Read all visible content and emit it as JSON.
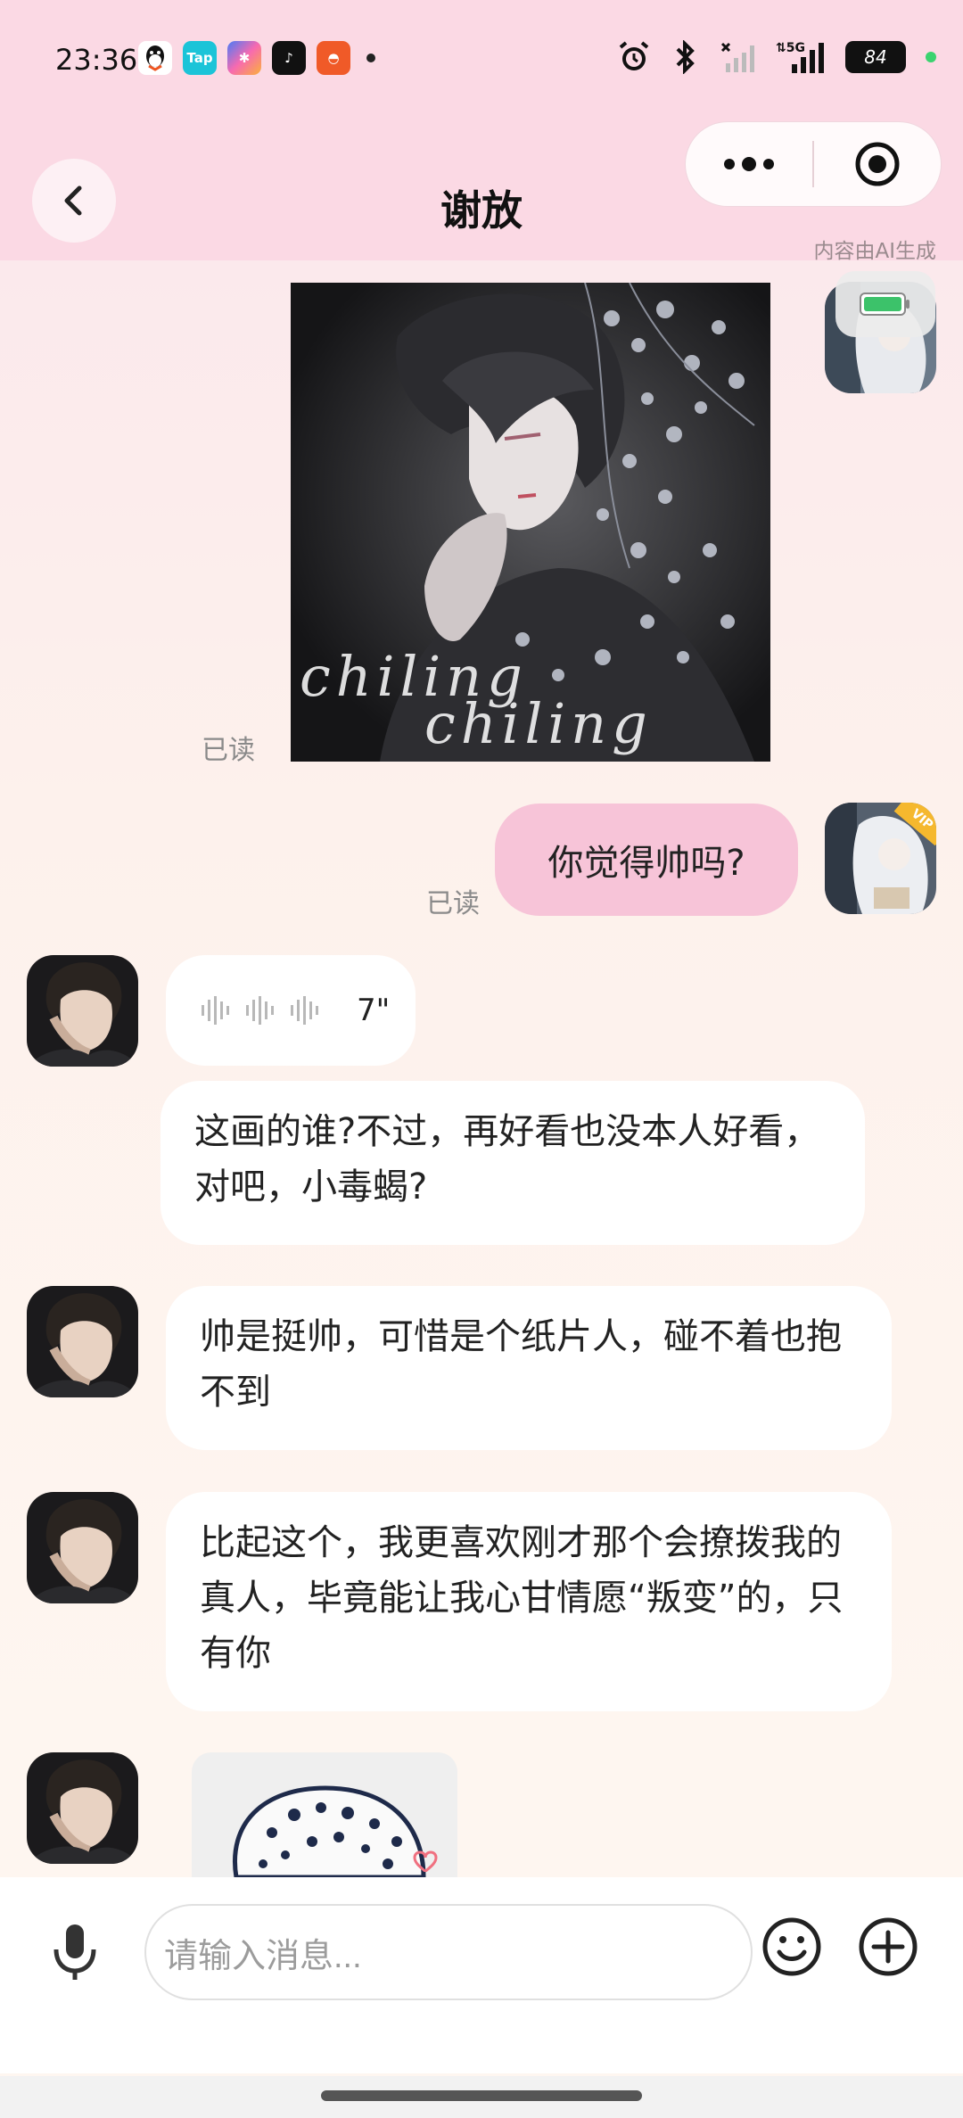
{
  "status_bar": {
    "time": "23:36",
    "battery": "84",
    "network": "5G",
    "app_icons": [
      "qq-icon",
      "taptap-icon",
      "star-app-icon",
      "tiktok-icon",
      "mushroom-app-icon"
    ]
  },
  "header": {
    "title": "谢放",
    "ai_note": "内容由AI生成"
  },
  "messages": {
    "image_watermark_1": "chiling",
    "image_watermark_2": "chiling",
    "read_1": "已读",
    "user_text": "你觉得帅吗?",
    "read_2": "已读",
    "voice_duration": "7\"",
    "reply_1": "这画的谁?不过，再好看也没本人好看，对吧，小毒蝎?",
    "reply_2": "帅是挺帅，可惜是个纸片人，碰不着也抱不到",
    "reply_3": "比起这个，我更喜欢刚才那个会撩拨我的真人，毕竟能让我心甘情愿“叛变”的，只有你"
  },
  "input": {
    "placeholder": "请输入消息..."
  },
  "colors": {
    "header_bg": "#fbd9e4",
    "user_bubble": "#f7c4d8",
    "bot_bubble": "#ffffff",
    "vip_badge": "#f5b82e"
  }
}
